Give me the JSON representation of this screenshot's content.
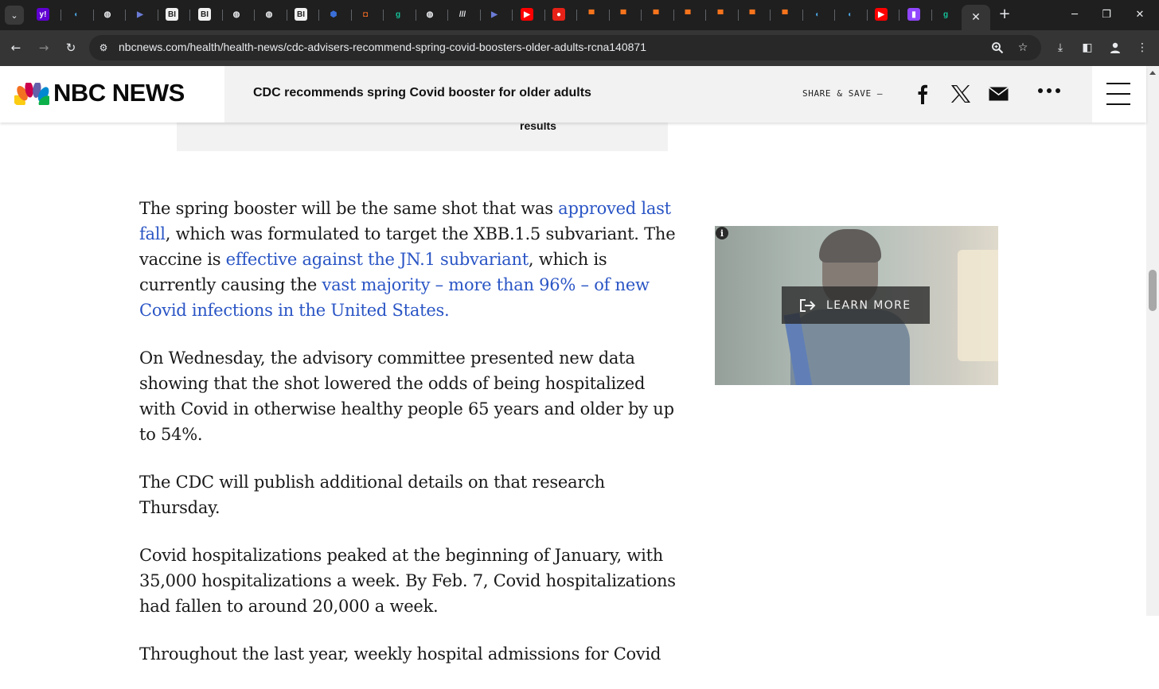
{
  "browser": {
    "tab_favicons": [
      {
        "name": "yahoo",
        "glyph": "y!",
        "bg": "#6001d2",
        "fg": "#ffffff"
      },
      {
        "name": "shield-blue",
        "glyph": "◖",
        "bg": "transparent",
        "fg": "#4aa3df"
      },
      {
        "name": "globe",
        "glyph": "◍",
        "bg": "transparent",
        "fg": "#e8eaed"
      },
      {
        "name": "arrow-blue",
        "glyph": "▶",
        "bg": "transparent",
        "fg": "#6b7bd6"
      },
      {
        "name": "business-insider",
        "glyph": "BI",
        "bg": "#f1f1f1",
        "fg": "#1f1f1f"
      },
      {
        "name": "business-insider",
        "glyph": "BI",
        "bg": "#f1f1f1",
        "fg": "#1f1f1f"
      },
      {
        "name": "globe",
        "glyph": "◍",
        "bg": "transparent",
        "fg": "#e8eaed"
      },
      {
        "name": "globe",
        "glyph": "◍",
        "bg": "transparent",
        "fg": "#e8eaed"
      },
      {
        "name": "business-insider",
        "glyph": "BI",
        "bg": "#f1f1f1",
        "fg": "#1f1f1f"
      },
      {
        "name": "cube-blue",
        "glyph": "⬢",
        "bg": "transparent",
        "fg": "#3b6fd8"
      },
      {
        "name": "shield-orange",
        "glyph": "◘",
        "bg": "transparent",
        "fg": "#f36c24"
      },
      {
        "name": "grammarly-g",
        "glyph": "g",
        "bg": "transparent",
        "fg": "#15c39a"
      },
      {
        "name": "globe",
        "glyph": "◍",
        "bg": "transparent",
        "fg": "#e8eaed"
      },
      {
        "name": "slashes",
        "glyph": "///",
        "bg": "transparent",
        "fg": "#e8eaed"
      },
      {
        "name": "arrow-blue",
        "glyph": "▶",
        "bg": "transparent",
        "fg": "#6b7bd6"
      },
      {
        "name": "youtube",
        "glyph": "▶",
        "bg": "#ff0000",
        "fg": "#ffffff"
      },
      {
        "name": "podcast-red",
        "glyph": "●",
        "bg": "#e62117",
        "fg": "#ffffff"
      },
      {
        "name": "bookmark-orange",
        "glyph": "▀",
        "bg": "transparent",
        "fg": "#f7741c"
      },
      {
        "name": "bookmark-orange",
        "glyph": "▀",
        "bg": "transparent",
        "fg": "#f7741c"
      },
      {
        "name": "bookmark-orange",
        "glyph": "▀",
        "bg": "transparent",
        "fg": "#f7741c"
      },
      {
        "name": "bookmark-orange",
        "glyph": "▀",
        "bg": "transparent",
        "fg": "#f7741c"
      },
      {
        "name": "bookmark-orange",
        "glyph": "▀",
        "bg": "transparent",
        "fg": "#f7741c"
      },
      {
        "name": "bookmark-orange",
        "glyph": "▀",
        "bg": "transparent",
        "fg": "#f7741c"
      },
      {
        "name": "bookmark-orange",
        "glyph": "▀",
        "bg": "transparent",
        "fg": "#f7741c"
      },
      {
        "name": "shield-blue",
        "glyph": "◖",
        "bg": "transparent",
        "fg": "#4aa3df"
      },
      {
        "name": "shield-blue",
        "glyph": "◖",
        "bg": "transparent",
        "fg": "#4aa3df"
      },
      {
        "name": "youtube",
        "glyph": "▶",
        "bg": "#ff0000",
        "fg": "#ffffff"
      },
      {
        "name": "twitch",
        "glyph": "▮",
        "bg": "#9146ff",
        "fg": "#ffffff"
      },
      {
        "name": "grammarly-g",
        "glyph": "g",
        "bg": "transparent",
        "fg": "#15c39a"
      }
    ],
    "active_tab_close": "✕",
    "new_tab": "+",
    "url": "nbcnews.com/health/health-news/cdc-advisers-recommend-spring-covid-boosters-older-adults-rcna140871"
  },
  "site": {
    "wordmark": "NBC NEWS",
    "headline": "CDC recommends spring Covid booster for older adults",
    "share_label": "SHARE & SAVE —",
    "peacock_colors": [
      "#fccc12",
      "#f37021",
      "#cc004c",
      "#6460aa",
      "#0089d0",
      "#0db14b"
    ]
  },
  "article": {
    "prior_box_text": "results",
    "paragraphs": {
      "p1": {
        "t1": "The spring booster will be the same shot that was ",
        "l1": "approved last fall",
        "t2": ", which was formulated to target the XBB.1.5 subvariant. The vaccine is ",
        "l2": "effective against the JN.1 subvariant",
        "t3": ", which is currently causing the ",
        "l3": "vast majority – more than 96% – of new Covid infections in the United States."
      },
      "p2": "On Wednesday, the advisory committee presented new data showing that the shot lowered the odds of being hospitalized with Covid in otherwise healthy people 65 years and older by up to 54%.",
      "p3": "The CDC will publish additional details on that research Thursday.",
      "p4": "Covid hospitalizations peaked at the beginning of January, with 35,000 hospitalizations a week. By Feb. 7, Covid hospitalizations had fallen to around 20,000 a week.",
      "p5": "Throughout the last year, weekly hospital admissions for Covid"
    },
    "link_color": "#2a55c5"
  },
  "ad": {
    "info_glyph": "i",
    "cta_label": "LEARN MORE"
  }
}
